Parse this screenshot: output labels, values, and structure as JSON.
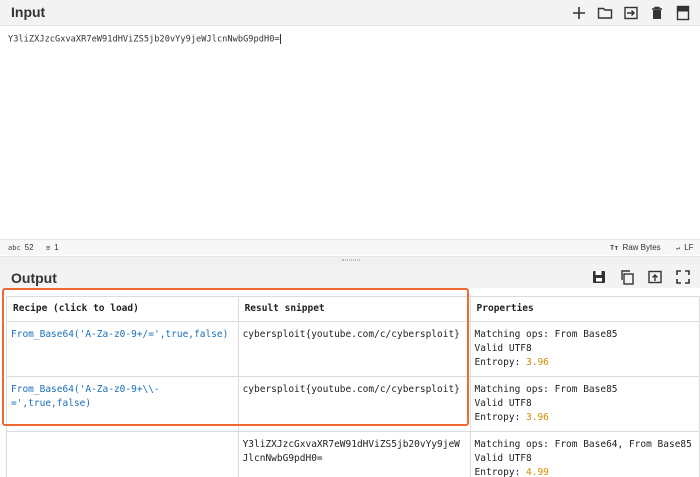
{
  "input": {
    "title": "Input",
    "text": "Y3liZXJzcGxvaXR7eW91dHViZS5jb20vYy9jeWJlcnNwbG9pdH0=",
    "status": {
      "length_value": "52",
      "lines_value": "1",
      "raw_bytes": "Raw Bytes",
      "line_ending": "LF"
    }
  },
  "toolbar_icons": [
    "add-icon",
    "open-folder-icon",
    "import-icon",
    "trash-icon",
    "layout-icon"
  ],
  "output": {
    "title": "Output",
    "icons": [
      "save-icon",
      "copy-icon",
      "replace-input-icon",
      "maximize-icon"
    ]
  },
  "table": {
    "headers": {
      "recipe": "Recipe (click to load)",
      "snippet": "Result snippet",
      "properties": "Properties"
    },
    "rows": [
      {
        "recipe": "From_Base64('A-Za-z0-9+/=',true,false)",
        "snippet": "cybersploit{youtube.com/c/cybersploit}",
        "props": [
          "Matching ops: From Base85",
          "Valid UTF8"
        ],
        "entropy_label": "Entropy: ",
        "entropy_value": "3.96"
      },
      {
        "recipe_line1": "From_Base64('A-Za-z0-9+\\\\-",
        "recipe_line2": "=',true,false)",
        "snippet": "cybersploit{youtube.com/c/cybersploit}",
        "props": [
          "Matching ops: From Base85",
          "Valid UTF8"
        ],
        "entropy_label": "Entropy: ",
        "entropy_value": "3.96"
      },
      {
        "recipe": "",
        "snippet_line1": "Y3liZXJzcGxvaXR7eW91dHViZS5jb20vYy9jeW",
        "snippet_line2": "JlcnNwbG9pdH0=",
        "props": [
          "Matching ops: From Base64, From Base85",
          "Valid UTF8"
        ],
        "entropy_label": "Entropy: ",
        "entropy_value": "4.99"
      }
    ]
  },
  "colors": {
    "accent_highlight": "#ee6a33",
    "link": "#1a6fb8",
    "entropy": "#d08b00"
  }
}
